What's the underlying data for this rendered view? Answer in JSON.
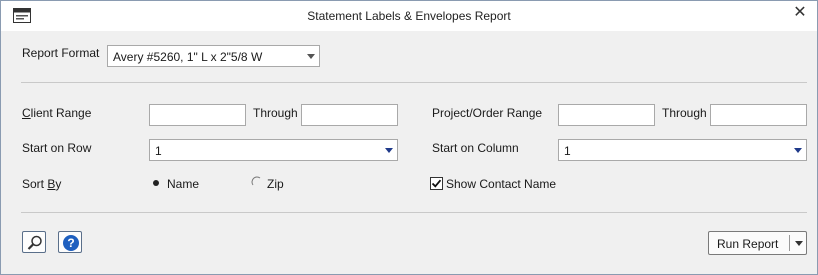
{
  "window": {
    "title": "Statement Labels & Envelopes Report",
    "close_glyph": "✕"
  },
  "report_format": {
    "label": "Report Format",
    "value": "Avery #5260, 1\" L x 2\"5/8 W"
  },
  "client_range": {
    "label_first": "C",
    "label_rest": "lient Range",
    "from": "",
    "through_label": "Through",
    "to": ""
  },
  "project_range": {
    "label": "Project/Order Range",
    "from": "",
    "through_label": "Through",
    "to": ""
  },
  "start_row": {
    "label": "Start on Row",
    "value": "1"
  },
  "start_column": {
    "label": "Start on Column",
    "value": "1"
  },
  "sort_by": {
    "label_first": "Sort ",
    "label_underlined": "B",
    "label_rest": "y",
    "options": [
      {
        "label": "Name",
        "selected": true
      },
      {
        "label": "Zip",
        "selected": false
      }
    ]
  },
  "show_contact_name": {
    "label": "Show Contact Name",
    "checked": true
  },
  "footer": {
    "run_report_label": "Run Report"
  },
  "icons": {
    "preview": "magnifier-icon",
    "help": "help-icon"
  },
  "colors": {
    "help_blue": "#1e5fbf",
    "dropdown_arrow": "#1f3a8a"
  }
}
